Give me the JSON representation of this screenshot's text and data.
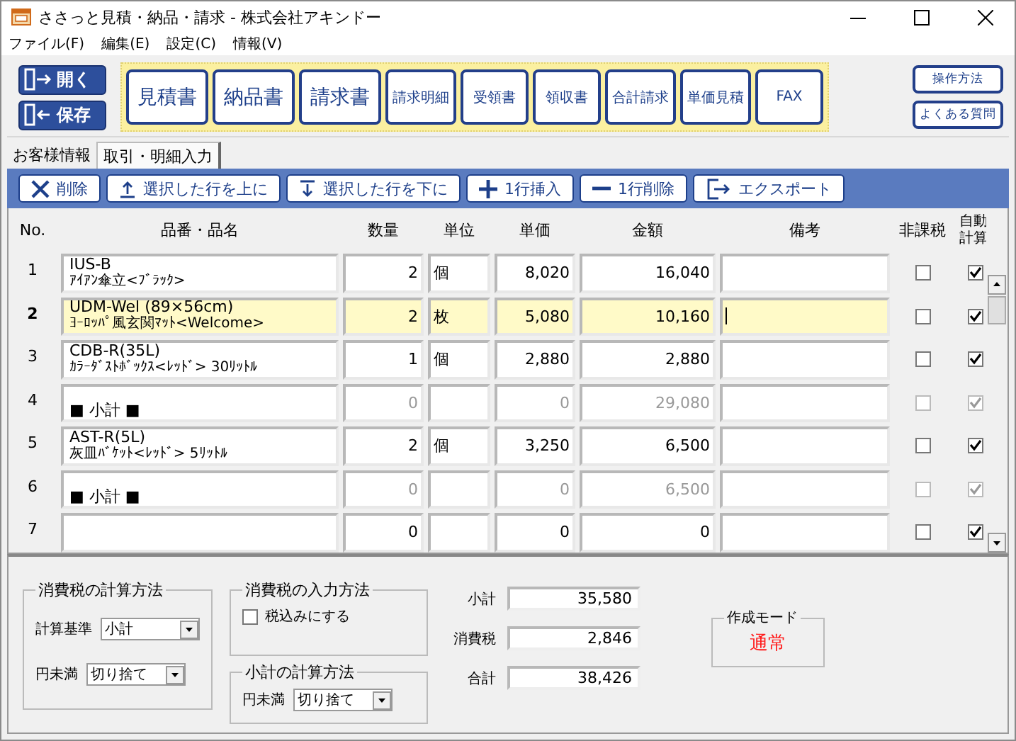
{
  "window": {
    "title": "ささっと見積・納品・請求 - 株式会社アキンドー"
  },
  "menu": [
    "ファイル(F)",
    "編集(E)",
    "設定(C)",
    "情報(V)"
  ],
  "file_buttons": [
    {
      "label": "開く",
      "kind": "open"
    },
    {
      "label": "保存",
      "kind": "save"
    }
  ],
  "document_buttons": [
    {
      "label": "見積書",
      "kind": "large"
    },
    {
      "label": "納品書",
      "kind": "large"
    },
    {
      "label": "請求書",
      "kind": "large"
    },
    {
      "label": "請求明細",
      "kind": "small"
    },
    {
      "label": "受領書",
      "kind": "small"
    },
    {
      "label": "領収書",
      "kind": "small"
    },
    {
      "label": "合計請求",
      "kind": "small"
    },
    {
      "label": "単価見積",
      "kind": "small"
    },
    {
      "label": "FAX",
      "kind": "small"
    }
  ],
  "help_buttons": [
    "操作方法",
    "よくある質問"
  ],
  "tabs": [
    {
      "label": "お客様情報",
      "selected": false
    },
    {
      "label": "取引・明細入力",
      "selected": true
    }
  ],
  "row_actions": [
    {
      "label": "削除",
      "kind": "delete"
    },
    {
      "label": "選択した行を上に",
      "kind": "up"
    },
    {
      "label": "選択した行を下に",
      "kind": "down"
    },
    {
      "label": "1行挿入",
      "kind": "insert"
    },
    {
      "label": "1行削除",
      "kind": "remove"
    },
    {
      "label": "エクスポート",
      "kind": "export"
    }
  ],
  "columns": [
    "No.",
    "品番・品名",
    "数量",
    "単位",
    "単価",
    "金額",
    "備考",
    "非課税",
    "自動計算"
  ],
  "rows": [
    {
      "no": "1",
      "kind": "item",
      "code": "IUS-B",
      "name": "ｱｲｱﾝ傘立<ﾌﾞﾗｯｸ>",
      "qty": "2",
      "unit": "個",
      "price": "8,020",
      "amount": "16,040",
      "tax_exempt": false,
      "auto": true,
      "selected": false
    },
    {
      "no": "2",
      "kind": "item",
      "code": "UDM-Wel (89×56cm)",
      "name": "ﾖｰﾛｯﾊﾟ風玄関ﾏｯﾄ<Welcome>",
      "qty": "2",
      "unit": "枚",
      "price": "5,080",
      "amount": "10,160",
      "tax_exempt": false,
      "auto": true,
      "selected": true
    },
    {
      "no": "3",
      "kind": "item",
      "code": "CDB-R(35L)",
      "name": "ｶﾗｰﾀﾞｽﾄﾎﾞｯｸｽ<ﾚｯﾄﾞ> 30ﾘｯﾄﾙ",
      "qty": "1",
      "unit": "個",
      "price": "2,880",
      "amount": "2,880",
      "tax_exempt": false,
      "auto": true,
      "selected": false
    },
    {
      "no": "4",
      "kind": "subtotal",
      "name": "■ 小計 ■",
      "qty": "0",
      "price": "0",
      "amount": "29,080",
      "tax_exempt": false,
      "auto": true,
      "selected": false
    },
    {
      "no": "5",
      "kind": "item",
      "code": "AST-R(5L)",
      "name": "灰皿ﾊﾞｹｯﾄ<ﾚｯﾄﾞ> 5ﾘｯﾄﾙ",
      "qty": "2",
      "unit": "個",
      "price": "3,250",
      "amount": "6,500",
      "tax_exempt": false,
      "auto": true,
      "selected": false
    },
    {
      "no": "6",
      "kind": "subtotal",
      "name": "■ 小計 ■",
      "qty": "0",
      "price": "0",
      "amount": "6,500",
      "tax_exempt": false,
      "auto": true,
      "selected": false
    },
    {
      "no": "7",
      "kind": "item",
      "qty": "0",
      "price": "0",
      "amount": "0",
      "tax_exempt": false,
      "auto": true,
      "selected": false
    }
  ],
  "tax_calc": {
    "title": "消費税の計算方法",
    "fields": [
      {
        "label": "計算基準",
        "value": "小計"
      },
      {
        "label": "円未満",
        "value": "切り捨て"
      }
    ]
  },
  "tax_input": {
    "title": "消費税の入力方法",
    "option": {
      "label": "税込みにする",
      "checked": false
    }
  },
  "subtotal_calc": {
    "title": "小計の計算方法",
    "field": {
      "label": "円未満",
      "value": "切り捨て"
    }
  },
  "totals": [
    {
      "label": "小計",
      "value": "35,580"
    },
    {
      "label": "消費税",
      "value": "2,846"
    },
    {
      "label": "合計",
      "value": "38,426"
    }
  ],
  "mode": {
    "title": "作成モード",
    "value": "通常"
  }
}
